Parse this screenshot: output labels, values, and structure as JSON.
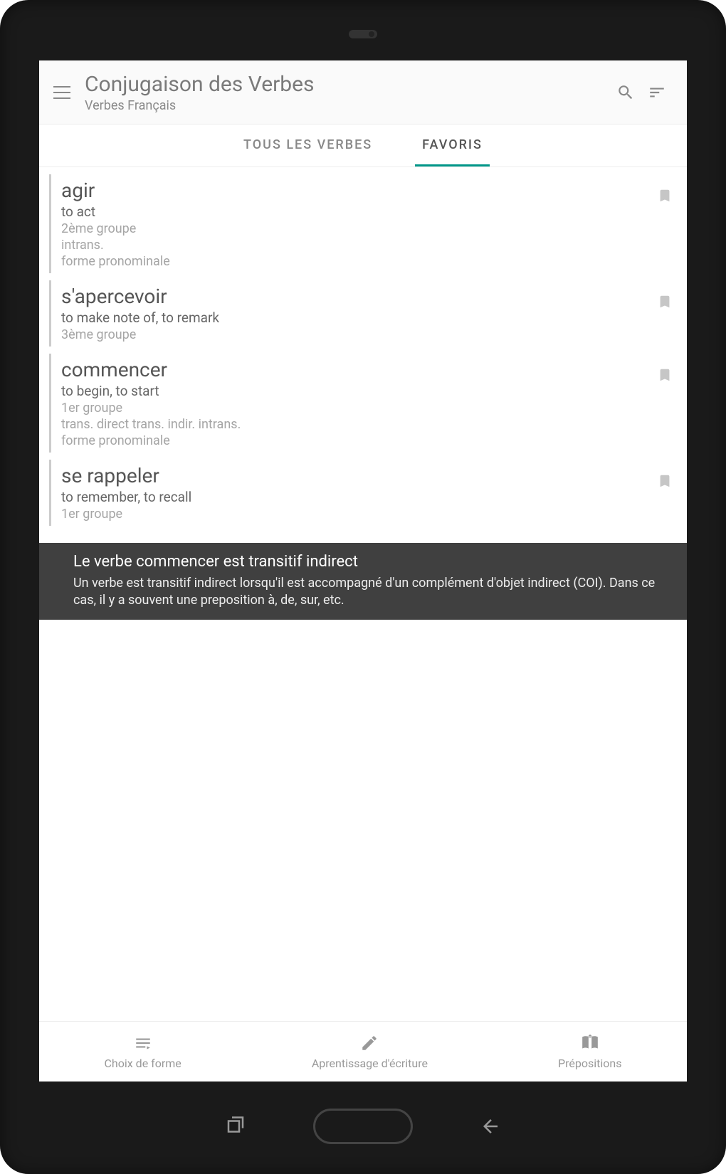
{
  "header": {
    "title": "Conjugaison des Verbes",
    "subtitle": "Verbes Français"
  },
  "tabs": {
    "all": "TOUS LES VERBES",
    "fav": "FAVORIS"
  },
  "items": [
    {
      "verb": "agir",
      "translation": "to act",
      "group": "2ème groupe",
      "type": "intrans.",
      "form": "forme pronominale"
    },
    {
      "verb": "s'apercevoir",
      "translation": "to make note of, to remark",
      "group": "3ème groupe",
      "type": "",
      "form": ""
    },
    {
      "verb": "commencer",
      "translation": "to begin, to start",
      "group": "1er groupe",
      "type": "trans. direct  trans. indir.  intrans.",
      "form": "forme pronominale"
    },
    {
      "verb": "se rappeler",
      "translation": "to remember, to recall",
      "group": "1er groupe",
      "type": "",
      "form": ""
    }
  ],
  "toast": {
    "title": "Le verbe commencer est transitif indirect",
    "body": "Un verbe est transitif indirect lorsqu'il est accompagné d'un complément d'objet indirect (COI). Dans ce cas, il y a souvent une preposition à, de, sur, etc."
  },
  "bottomnav": {
    "form": "Choix de forme",
    "writing": "Aprentissage d'écriture",
    "prep": "Prépositions"
  }
}
